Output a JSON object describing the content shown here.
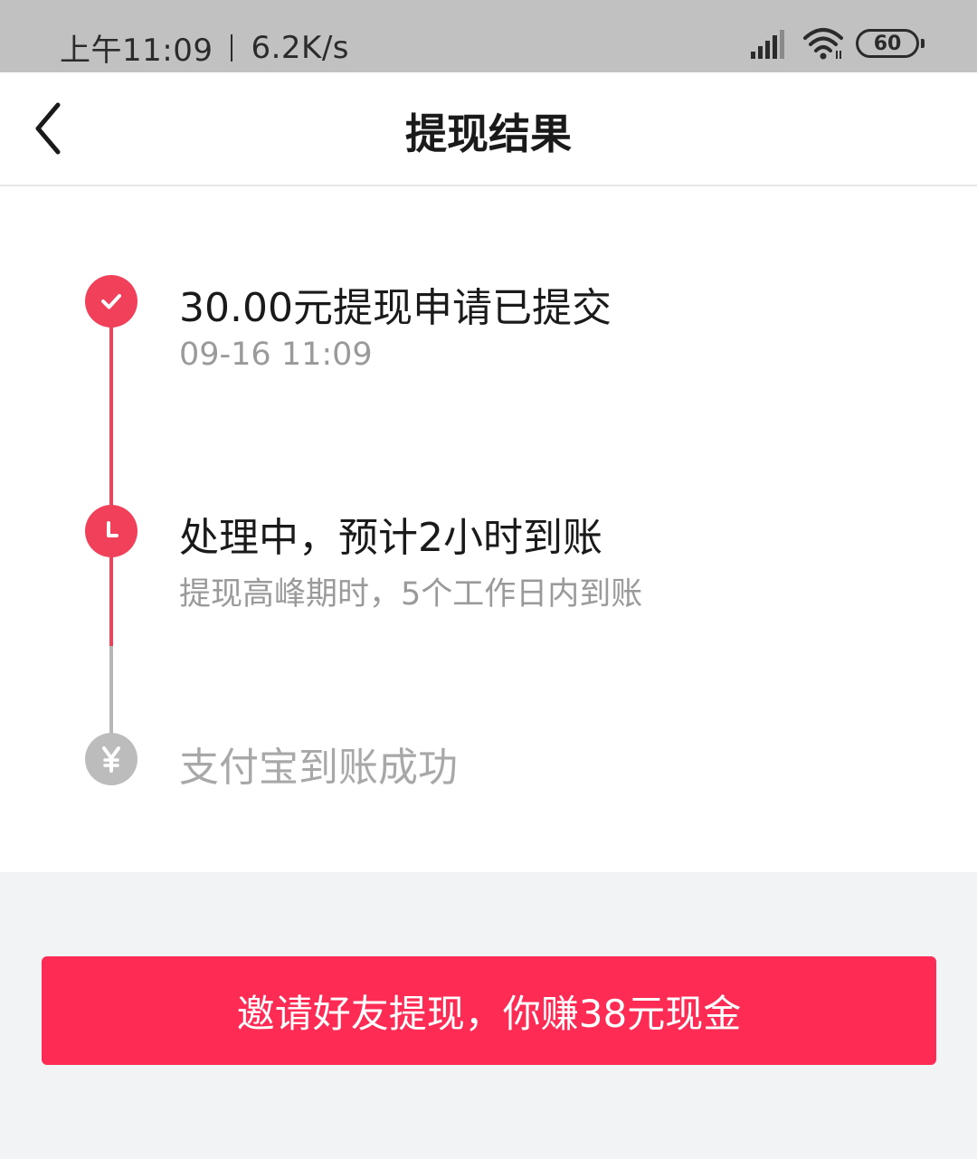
{
  "status_bar": {
    "time": "上午11:09",
    "network_speed": "6.2K/s",
    "battery_level": "60",
    "icons": [
      "signal-icon",
      "wifi-icon",
      "battery-icon"
    ]
  },
  "header": {
    "back_icon": "chevron-left-icon",
    "title": "提现结果"
  },
  "timeline": {
    "steps": [
      {
        "title": "30.00元提现申请已提交",
        "subtitle": "09-16 11:09",
        "status": "done",
        "icon": "check-icon"
      },
      {
        "title": "处理中，预计2小时到账",
        "subtitle": "提现高峰期时，5个工作日内到账",
        "status": "active",
        "icon": "clock-icon"
      },
      {
        "title": "支付宝到账成功",
        "status": "pending",
        "icon": "yen-icon"
      }
    ]
  },
  "invite_button": {
    "label": "邀请好友提现，你赚38元现金"
  },
  "colors": {
    "accent": "#fe2c55",
    "timeline_active": "#f0405a",
    "timeline_pending": "#bcbcbc",
    "page_background": "#f2f3f5"
  }
}
